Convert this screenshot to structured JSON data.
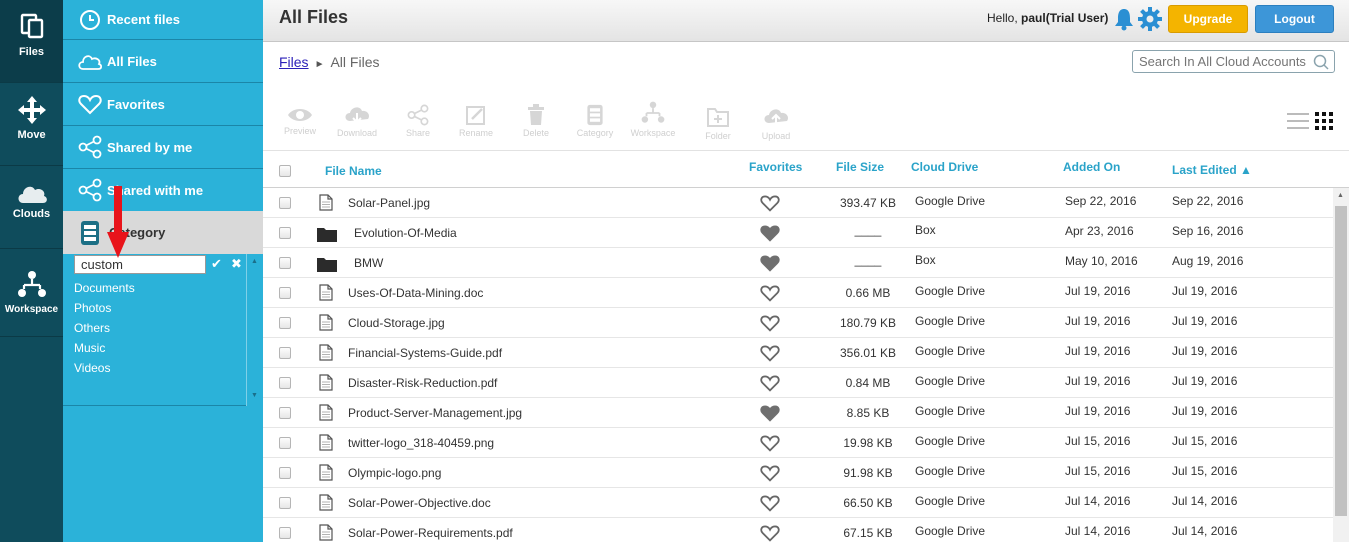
{
  "rail": {
    "items": [
      {
        "label": "Files",
        "icon": "files-icon"
      },
      {
        "label": "Move",
        "icon": "move-icon"
      },
      {
        "label": "Clouds",
        "icon": "cloud-icon"
      },
      {
        "label": "Workspace",
        "icon": "workspace-icon"
      }
    ]
  },
  "sidebar": {
    "items": [
      {
        "label": "Recent files",
        "icon": "clock-icon"
      },
      {
        "label": "All Files",
        "icon": "cloud-icon"
      },
      {
        "label": "Favorites",
        "icon": "heart-icon"
      },
      {
        "label": "Shared by me",
        "icon": "share-icon"
      },
      {
        "label": "Shared with me",
        "icon": "share-icon"
      }
    ],
    "category": {
      "label": "Category",
      "input_value": "custom",
      "items": [
        "Documents",
        "Photos",
        "Others",
        "Music",
        "Videos"
      ]
    }
  },
  "header": {
    "title": "All Files",
    "hello": "Hello,",
    "user": "paul(Trial User)",
    "upgrade_label": "Upgrade",
    "logout_label": "Logout"
  },
  "breadcrumb": {
    "root": "Files",
    "separator": "►",
    "current": "All Files"
  },
  "search": {
    "placeholder": "Search In All Cloud Accounts"
  },
  "toolbar": {
    "tools": [
      {
        "label": "Preview",
        "icon": "eye-icon"
      },
      {
        "label": "Download",
        "icon": "download-icon"
      },
      {
        "label": "Share",
        "icon": "share-icon"
      },
      {
        "label": "Rename",
        "icon": "rename-icon"
      },
      {
        "label": "Delete",
        "icon": "trash-icon"
      },
      {
        "label": "Category",
        "icon": "category-icon"
      },
      {
        "label": "Workspace",
        "icon": "workspace-icon"
      },
      {
        "label": "Folder",
        "icon": "folder-plus-icon"
      },
      {
        "label": "Upload",
        "icon": "upload-icon"
      }
    ]
  },
  "table": {
    "columns": {
      "name": "File Name",
      "favorites": "Favorites",
      "size": "File Size",
      "drive": "Cloud Drive",
      "added": "Added On",
      "edited": "Last Edited ▲"
    },
    "rows": [
      {
        "type": "file",
        "name": "Solar-Panel.jpg",
        "fav": false,
        "size": "393.47 KB",
        "drive": "Google Drive",
        "added": "Sep 22, 2016",
        "edited": "Sep 22, 2016"
      },
      {
        "type": "folder",
        "name": "Evolution-Of-Media",
        "fav": true,
        "size": "____",
        "drive": "Box",
        "added": "Apr 23, 2016",
        "edited": "Sep 16, 2016"
      },
      {
        "type": "folder",
        "name": "BMW",
        "fav": true,
        "size": "____",
        "drive": "Box",
        "added": "May 10, 2016",
        "edited": "Aug 19, 2016"
      },
      {
        "type": "file",
        "name": "Uses-Of-Data-Mining.doc",
        "fav": false,
        "size": "0.66 MB",
        "drive": "Google Drive",
        "added": "Jul 19, 2016",
        "edited": "Jul 19, 2016"
      },
      {
        "type": "file",
        "name": "Cloud-Storage.jpg",
        "fav": false,
        "size": "180.79 KB",
        "drive": "Google Drive",
        "added": "Jul 19, 2016",
        "edited": "Jul 19, 2016"
      },
      {
        "type": "file",
        "name": "Financial-Systems-Guide.pdf",
        "fav": false,
        "size": "356.01 KB",
        "drive": "Google Drive",
        "added": "Jul 19, 2016",
        "edited": "Jul 19, 2016"
      },
      {
        "type": "file",
        "name": "Disaster-Risk-Reduction.pdf",
        "fav": false,
        "size": "0.84 MB",
        "drive": "Google Drive",
        "added": "Jul 19, 2016",
        "edited": "Jul 19, 2016"
      },
      {
        "type": "file",
        "name": "Product-Server-Management.jpg",
        "fav": true,
        "size": "8.85 KB",
        "drive": "Google Drive",
        "added": "Jul 19, 2016",
        "edited": "Jul 19, 2016"
      },
      {
        "type": "file",
        "name": "twitter-logo_318-40459.png",
        "fav": false,
        "size": "19.98 KB",
        "drive": "Google Drive",
        "added": "Jul 15, 2016",
        "edited": "Jul 15, 2016"
      },
      {
        "type": "file",
        "name": "Olympic-logo.png",
        "fav": false,
        "size": "91.98 KB",
        "drive": "Google Drive",
        "added": "Jul 15, 2016",
        "edited": "Jul 15, 2016"
      },
      {
        "type": "file",
        "name": "Solar-Power-Objective.doc",
        "fav": false,
        "size": "66.50 KB",
        "drive": "Google Drive",
        "added": "Jul 14, 2016",
        "edited": "Jul 14, 2016"
      },
      {
        "type": "file",
        "name": "Solar-Power-Requirements.pdf",
        "fav": false,
        "size": "67.15 KB",
        "drive": "Google Drive",
        "added": "Jul 14, 2016",
        "edited": "Jul 14, 2016"
      }
    ]
  },
  "colors": {
    "rail": "#0f4c5c",
    "sidebar": "#2bb2d9",
    "accent": "#2aa3c9",
    "upgrade": "#f4b400",
    "logout": "#3d96d8"
  }
}
